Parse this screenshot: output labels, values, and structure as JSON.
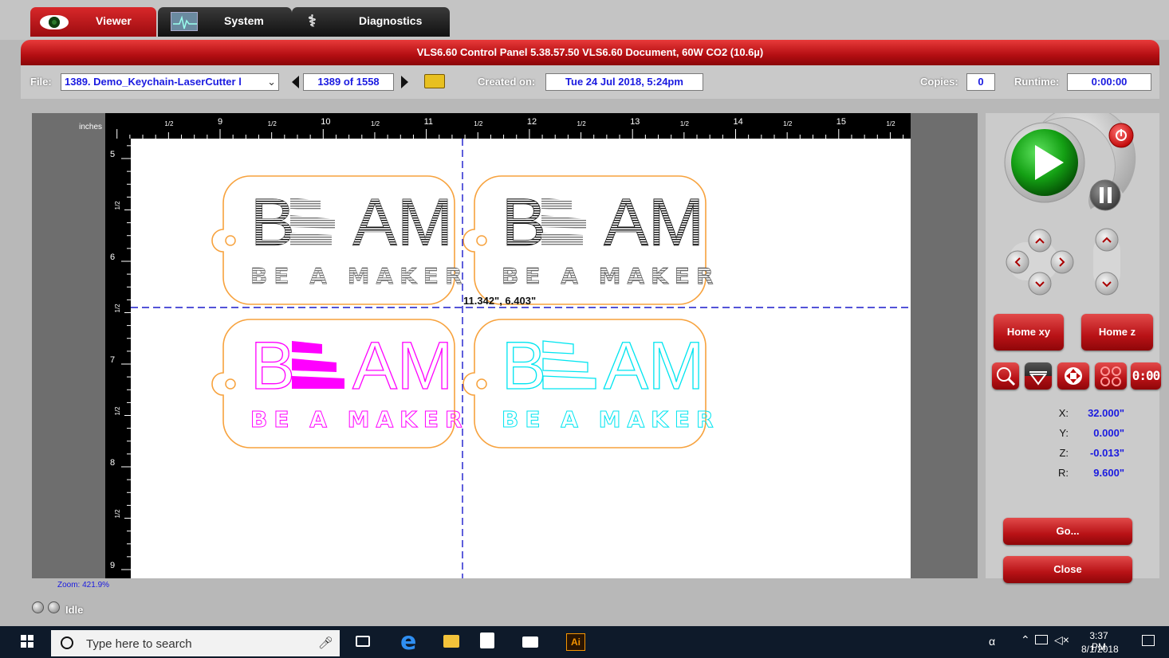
{
  "tabs": [
    {
      "label": "Viewer",
      "active": true
    },
    {
      "label": "System",
      "active": false
    },
    {
      "label": "Diagnostics",
      "active": false
    }
  ],
  "title": "VLS6.60  Control Panel  5.38.57.50    VLS6.60 Document, 60W CO2 (10.6µ)",
  "toolbar": {
    "file_label": "File:",
    "file_value": "1389. Demo_Keychain-LaserCutter l",
    "page_value": "1389 of 1558",
    "created_label": "Created on:",
    "created_value": "Tue 24 Jul 2018,  5:24pm",
    "copies_label": "Copies:",
    "copies_value": "0",
    "runtime_label": "Runtime:",
    "runtime_value": "0:00:00"
  },
  "ruler": {
    "units": "inches",
    "top_major": [
      "9",
      "10",
      "11",
      "12",
      "13",
      "14",
      "15"
    ],
    "half_label": "1/2",
    "left_major": [
      "5",
      "6",
      "7",
      "8",
      "9"
    ]
  },
  "canvas": {
    "crosshair_readout": "11.342\", 6.403\"",
    "keychain_word": "B  AM",
    "keychain_tagline": "BE A MAKER",
    "colors": {
      "outline": "#f7a23d",
      "black": "#111111",
      "magenta": "#ff00ff",
      "cyan": "#00e5f0",
      "crosshair": "#1a1acc"
    }
  },
  "zoom": "Zoom:  421.9%",
  "panel": {
    "home_xy": "Home xy",
    "home_z": "Home z",
    "coords": [
      {
        "label": "X:",
        "value": "32.000\""
      },
      {
        "label": "Y:",
        "value": "0.000\""
      },
      {
        "label": "Z:",
        "value": "-0.013\""
      },
      {
        "label": "R:",
        "value": "9.600\""
      }
    ],
    "go": "Go...",
    "close": "Close",
    "tool_icons": [
      "zoom-icon",
      "focus-icon",
      "move-icon",
      "pattern-icon",
      "counter-icon"
    ],
    "counter_text": "0:00"
  },
  "status": "Idle",
  "taskbar": {
    "search_placeholder": "Type here to search",
    "time": "3:37 PM",
    "date": "8/1/2018",
    "illustrator": "Ai"
  }
}
